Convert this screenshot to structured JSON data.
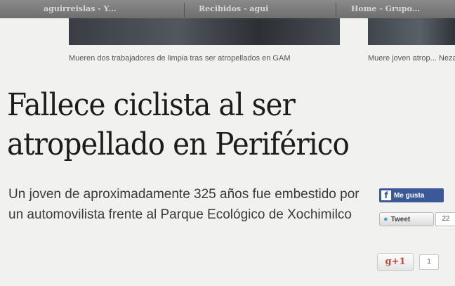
{
  "browser": {
    "tabs": [
      {
        "label": "aguirreislas - Y..."
      },
      {
        "label": "Recibidos - agui"
      },
      {
        "label": "Home - Grupo..."
      }
    ]
  },
  "related": [
    {
      "title": "Mueren dos trabajadores de limpia tras ser atropellados en GAM"
    },
    {
      "title": "Muere joven atrop... Nezahualcóyotl"
    }
  ],
  "article": {
    "headline_line1": "Fallece ciclista al ser",
    "headline_line2": "atropellado en Periférico",
    "summary": "Un joven de aproximadamente 325 años fue embestido por un automovilista frente al Parque Ecológico de Xochimilco"
  },
  "share": {
    "facebook_label": "Me gusta",
    "facebook_icon": "f",
    "tweet_label": "Tweet",
    "tweet_count": "22",
    "gplus_label": "g+1",
    "gplus_count": "1"
  }
}
